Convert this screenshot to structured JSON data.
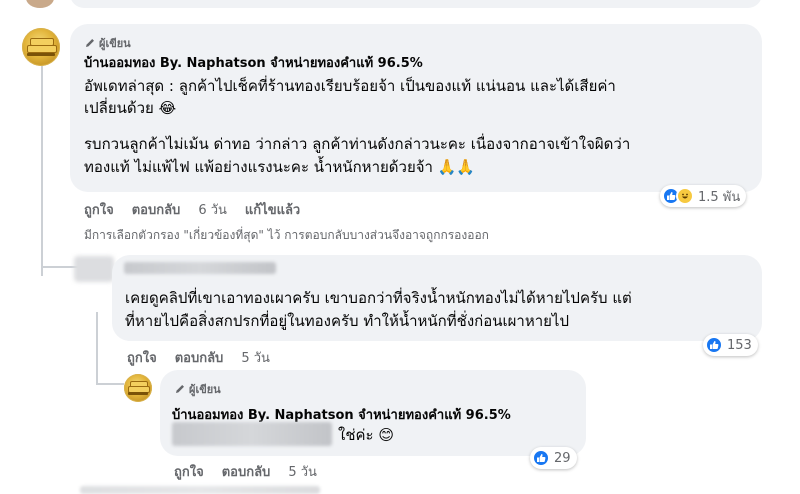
{
  "comment1": {
    "author_badge": "ผู้เขียน",
    "author_name": "บ้านออมทอง By. Naphatson จำหน่ายทองคำแท้ 96.5%",
    "line1": "อัพเดทล่าสุด : ลูกค้าไปเช็คที่ร้านทองเรียบร้อยจ้า เป็นของแท้ แน่นอน และได้เสียค่า",
    "line2": "เปลี่ยนด้วย 😂",
    "line3": "รบกวนลูกค้าไม่เม้น ด่าทอ ว่ากล่าว ลูกค้าท่านดังกล่าวนะคะ เนื่องจากอาจเข้าใจผิดว่า",
    "line4": "ทองแท้ ไม่แพ้ไฟ แพ้อย่างแรงนะคะ น้ำหนักหายด้วยจ้า 🙏🙏",
    "like": "ถูกใจ",
    "reply": "ตอบกลับ",
    "time": "6 วัน",
    "edited": "แก้ไขแล้ว",
    "reaction_count": "1.5 พัน",
    "filter_note": "มีการเลือกตัวกรอง \"เกี่ยวข้องที่สุด\" ไว้ การตอบกลับบางส่วนจึงอาจถูกกรองออก"
  },
  "reply1": {
    "line1": "เคยดูคลิปที่เขาเอาทองเผาครับ เขาบอกว่าที่จริงน้ำหนักทองไม่ได้หายไปครับ แต่",
    "line2": "ที่หายไปคือสิ่งสกปรกที่อยู่ในทองครับ ทำให้น้ำหนักที่ชั่งก่อนเผาหายไป",
    "like": "ถูกใจ",
    "reply": "ตอบกลับ",
    "time": "5 วัน",
    "reaction_count": "153"
  },
  "reply2": {
    "author_badge": "ผู้เขียน",
    "author_name": "บ้านออมทอง By. Naphatson จำหน่ายทองคำแท้ 96.5%",
    "text": "ใช่ค่ะ 😊",
    "like": "ถูกใจ",
    "reply": "ตอบกลับ",
    "time": "5 วัน",
    "reaction_count": "29"
  },
  "colors": {
    "like_blue": "#1877f2",
    "bubble_gray": "#f0f2f5",
    "meta_gray": "#65676b"
  },
  "icons": [
    "pencil-icon",
    "like-icon",
    "haha-icon"
  ]
}
